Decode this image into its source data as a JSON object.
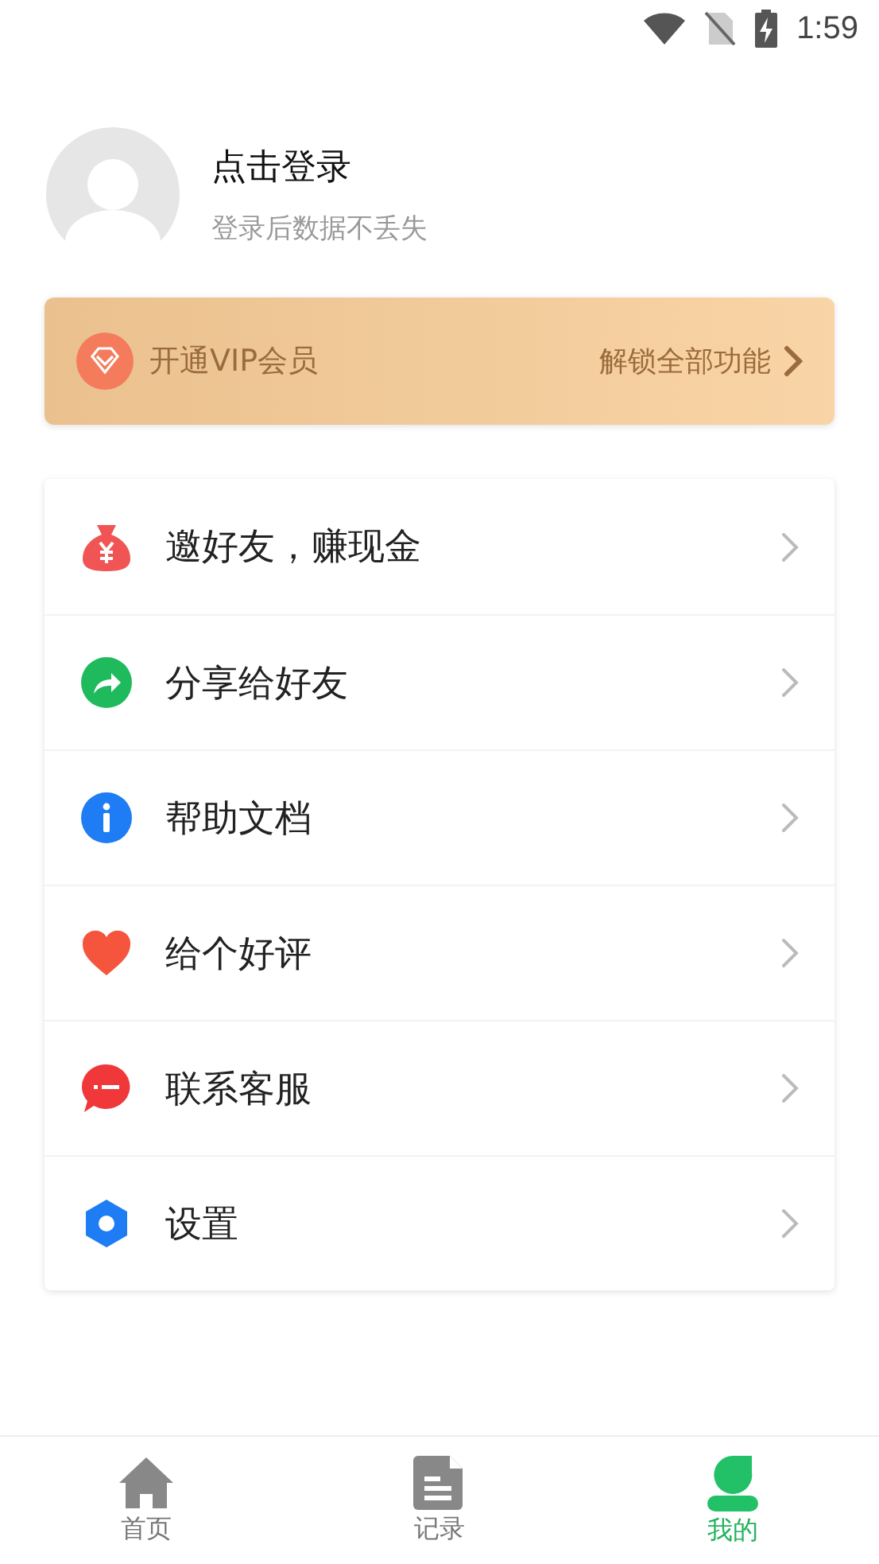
{
  "status_bar": {
    "time": "1:59"
  },
  "profile": {
    "title": "点击登录",
    "subtitle": "登录后数据不丢失"
  },
  "vip_banner": {
    "label": "开通VIP会员",
    "action": "解锁全部功能"
  },
  "menu": [
    {
      "kind": "moneybag",
      "label": "邀好友，赚现金"
    },
    {
      "kind": "share",
      "label": "分享给好友"
    },
    {
      "kind": "info",
      "label": "帮助文档"
    },
    {
      "kind": "heart",
      "label": "给个好评"
    },
    {
      "kind": "chat",
      "label": "联系客服"
    },
    {
      "kind": "settings",
      "label": "设置"
    }
  ],
  "tabs": [
    {
      "kind": "home",
      "label": "首页",
      "selected": false
    },
    {
      "kind": "records",
      "label": "记录",
      "selected": false
    },
    {
      "kind": "profile",
      "label": "我的",
      "selected": true
    }
  ]
}
